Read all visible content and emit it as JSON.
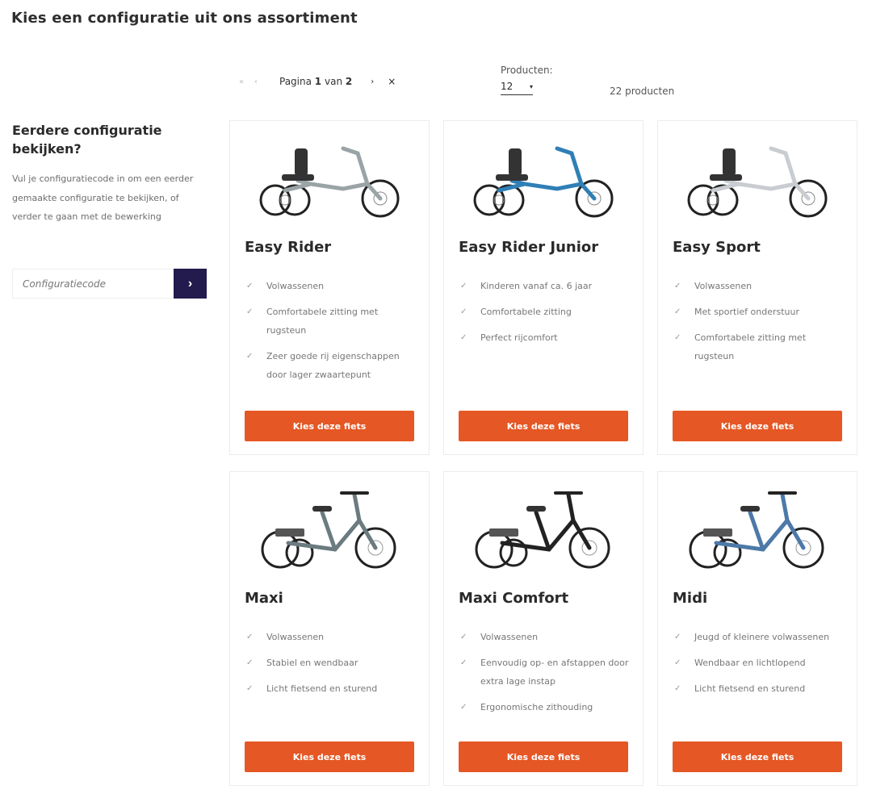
{
  "page": {
    "title": "Kies een configuratie uit ons assortiment"
  },
  "sidebar": {
    "heading": "Eerdere configuratie bekijken?",
    "text": "Vul je configuratiecode in om een eerder gemaakte configuratie te bekijken, of verder te gaan met de bewerking",
    "code_placeholder": "Configuratiecode",
    "submit_icon": "chevron-right-icon",
    "submit_glyph": "›",
    "submit_color": "#231a4d"
  },
  "pager": {
    "first_glyph": "«",
    "prev_glyph": "‹",
    "label_prefix": "Pagina",
    "current": "1",
    "label_sep": "van",
    "total": "2",
    "next_glyph": "›",
    "close_glyph": "×"
  },
  "per_page": {
    "label": "Producten:",
    "value": "12",
    "caret": "▾"
  },
  "count": "22 producten",
  "accent_color": "#e55724",
  "products": [
    {
      "name": "Easy Rider",
      "features": [
        "Volwassenen",
        "Comfortabele zitting met rugsteun",
        "Zeer goede rij eigenschappen door lager zwaartepunt"
      ],
      "button": "Kies deze fiets",
      "frame_color": "#9aa3a6"
    },
    {
      "name": "Easy Rider Junior",
      "features": [
        "Kinderen vanaf ca. 6 jaar",
        "Comfortabele zitting",
        "Perfect rijcomfort"
      ],
      "button": "Kies deze fiets",
      "frame_color": "#2f7fb6"
    },
    {
      "name": "Easy Sport",
      "features": [
        "Volwassenen",
        "Met sportief onderstuur",
        "Comfortabele zitting met rugsteun"
      ],
      "button": "Kies deze fiets",
      "frame_color": "#c9ccd0"
    },
    {
      "name": "Maxi",
      "features": [
        "Volwassenen",
        "Stabiel en wendbaar",
        "Licht fietsend en sturend"
      ],
      "button": "Kies deze fiets",
      "frame_color": "#6b7b80"
    },
    {
      "name": "Maxi Comfort",
      "features": [
        "Volwassenen",
        "Eenvoudig op- en afstappen door extra lage instap",
        "Ergonomische zithouding"
      ],
      "button": "Kies deze fiets",
      "frame_color": "#222222"
    },
    {
      "name": "Midi",
      "features": [
        "Jeugd of kleinere volwassenen",
        "Wendbaar en lichtlopend",
        "Licht fietsend en sturend"
      ],
      "button": "Kies deze fiets",
      "frame_color": "#4c79a8"
    }
  ]
}
